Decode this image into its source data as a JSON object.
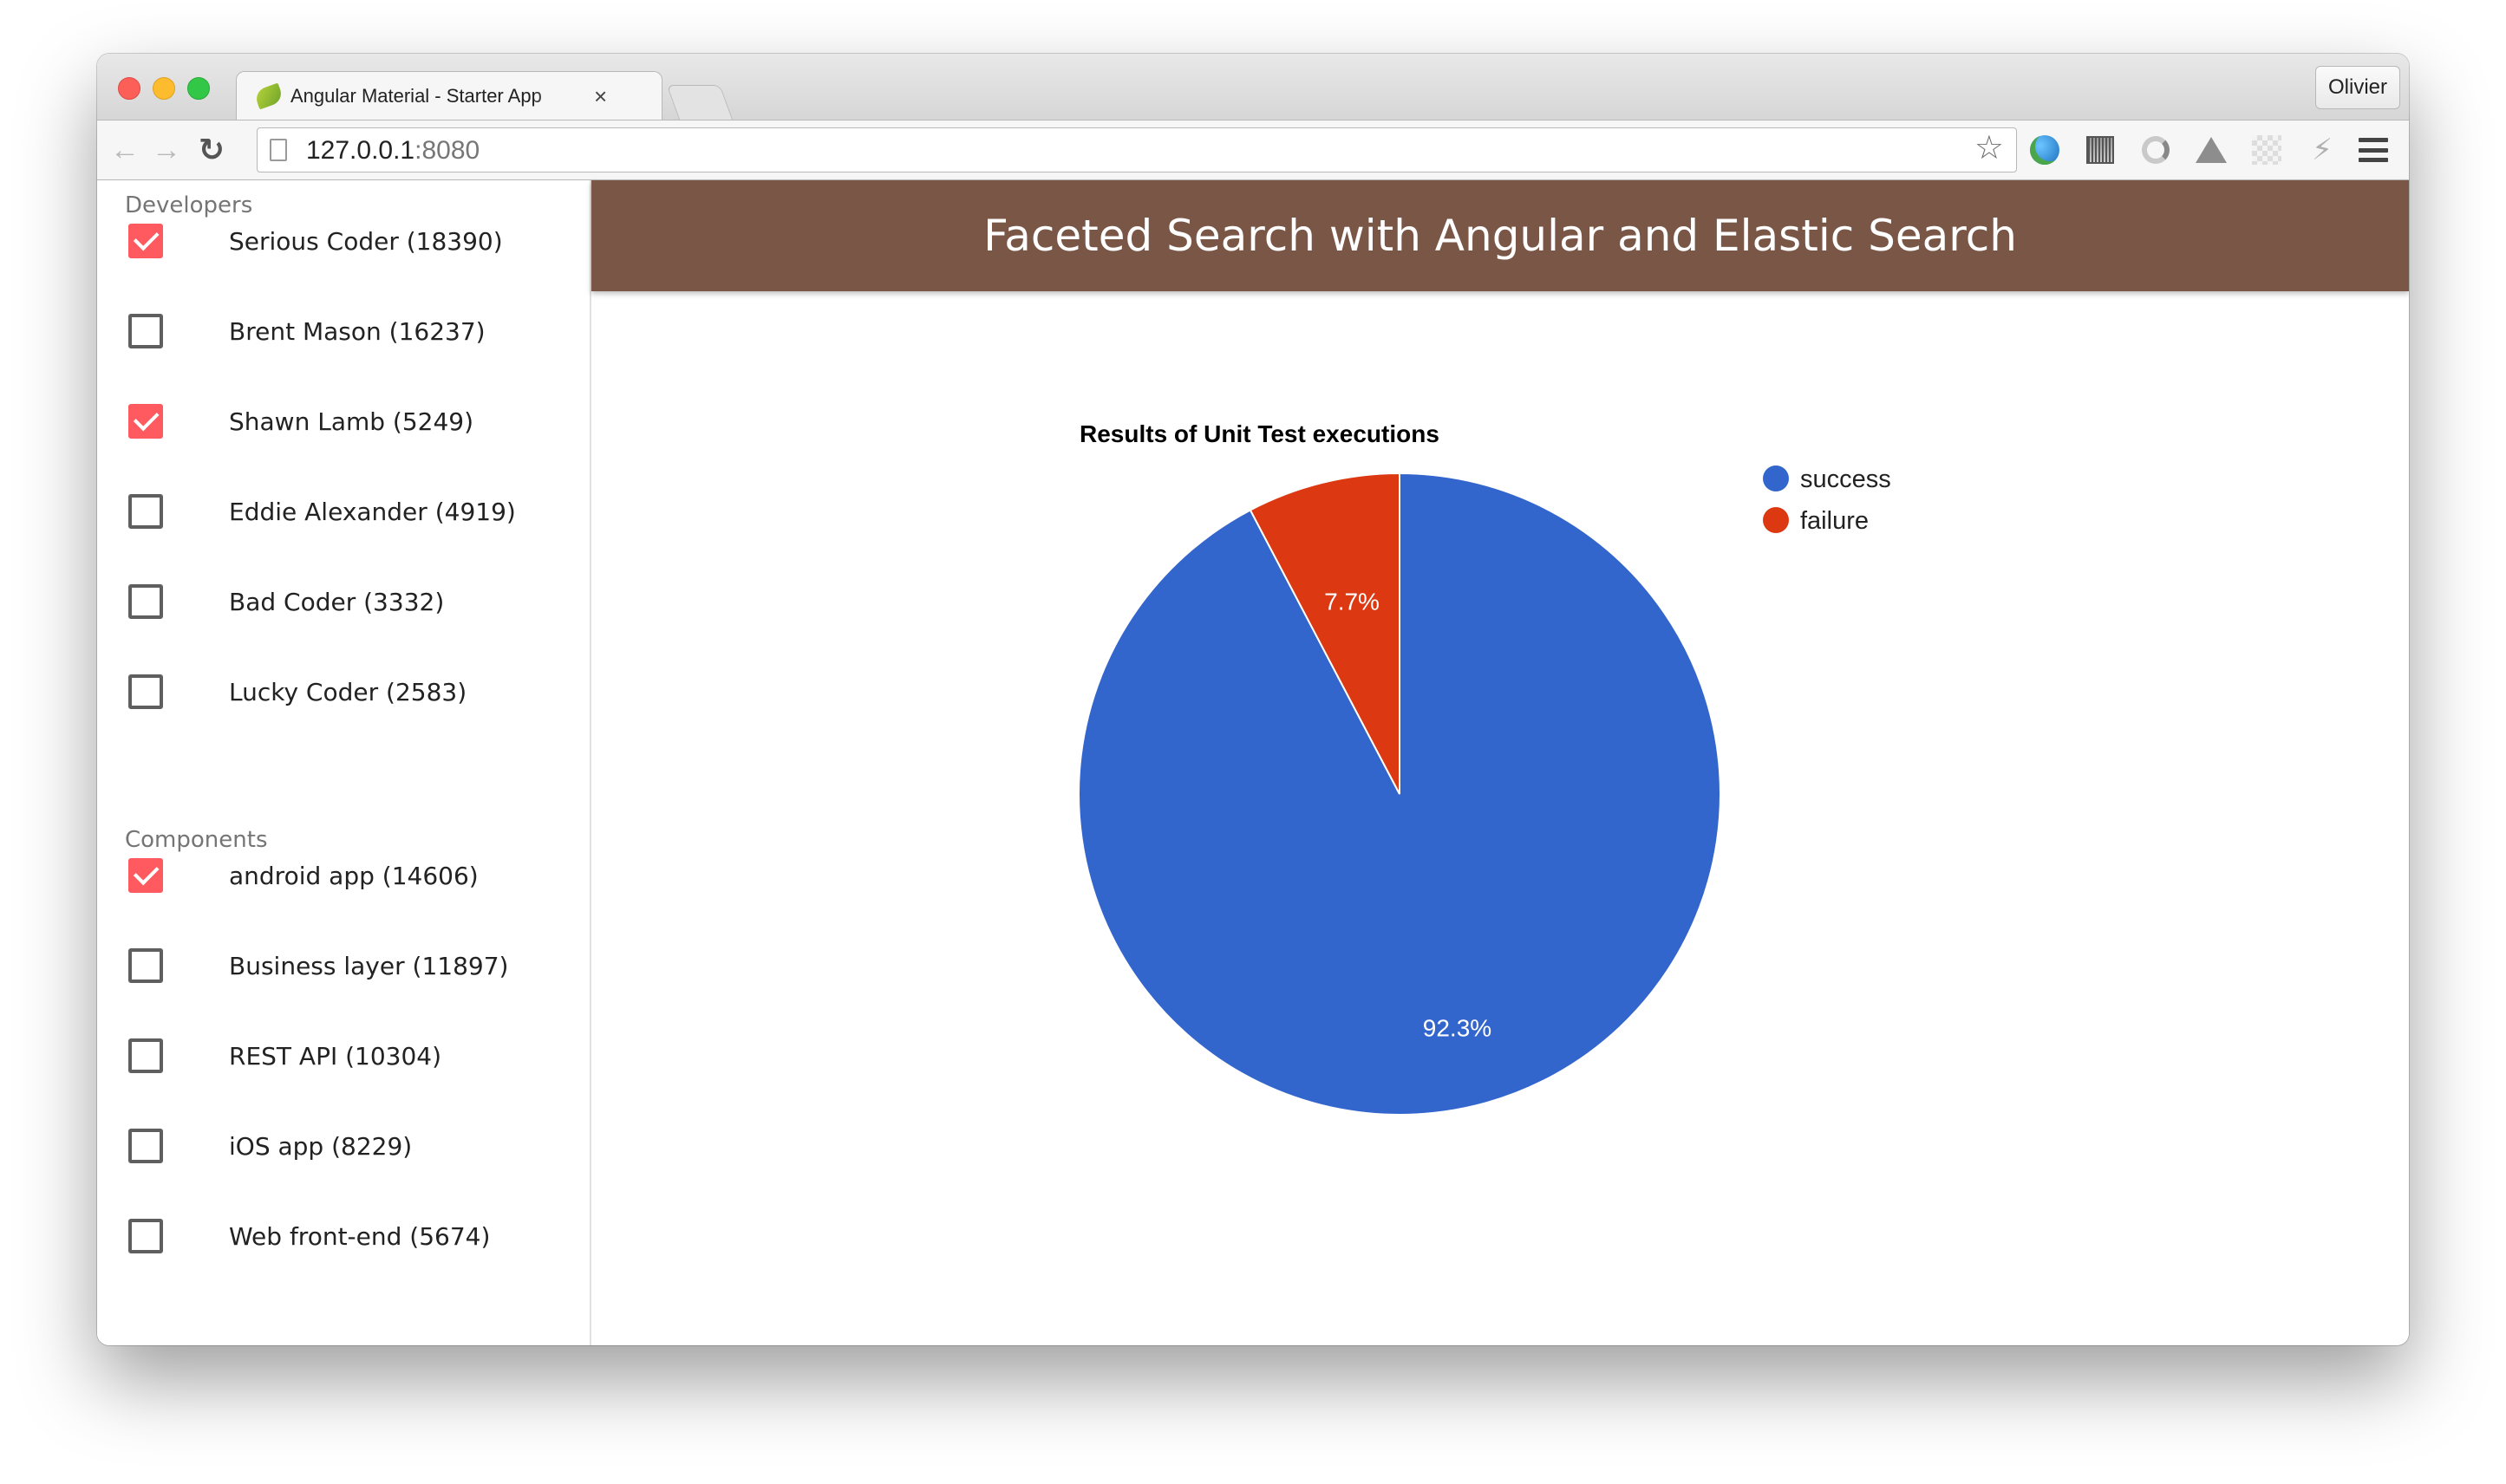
{
  "browser": {
    "tab_title": "Angular Material - Starter App",
    "tab_close": "×",
    "profile_name": "Olivier",
    "url_host": "127.0.0.1",
    "url_port": ":8080",
    "icons": [
      "back-arrow-icon",
      "forward-arrow-icon",
      "reload-icon",
      "page-icon",
      "star-icon",
      "globe-extension-icon",
      "qr-code-extension-icon",
      "swirl-extension-icon",
      "drive-extension-icon",
      "checker-extension-icon",
      "bolt-extension-icon",
      "menu-icon"
    ]
  },
  "sidebar": {
    "developers_header": "Developers",
    "developers": [
      {
        "label": "Serious Coder (18390)",
        "checked": true
      },
      {
        "label": "Brent Mason (16237)",
        "checked": false
      },
      {
        "label": "Shawn Lamb (5249)",
        "checked": true
      },
      {
        "label": "Eddie Alexander (4919)",
        "checked": false
      },
      {
        "label": "Bad Coder (3332)",
        "checked": false
      },
      {
        "label": "Lucky Coder (2583)",
        "checked": false
      }
    ],
    "components_header": "Components",
    "components": [
      {
        "label": "android app (14606)",
        "checked": true
      },
      {
        "label": "Business layer (11897)",
        "checked": false
      },
      {
        "label": "REST API (10304)",
        "checked": false
      },
      {
        "label": "iOS app (8229)",
        "checked": false
      },
      {
        "label": "Web front-end (5674)",
        "checked": false
      }
    ]
  },
  "header": {
    "title": "Faceted Search with Angular and Elastic Search"
  },
  "colors": {
    "toolbar": "#7a5647",
    "checkbox_checked": "#ff5a5f",
    "success": "#3366cc",
    "failure": "#dc3912"
  },
  "chart_data": {
    "type": "pie",
    "title": "Results of Unit Test executions",
    "categories": [
      "success",
      "failure"
    ],
    "values": [
      92.3,
      7.7
    ],
    "labels": [
      "92.3%",
      "7.7%"
    ],
    "colors": [
      "#3366cc",
      "#dc3912"
    ],
    "legend_position": "right"
  }
}
